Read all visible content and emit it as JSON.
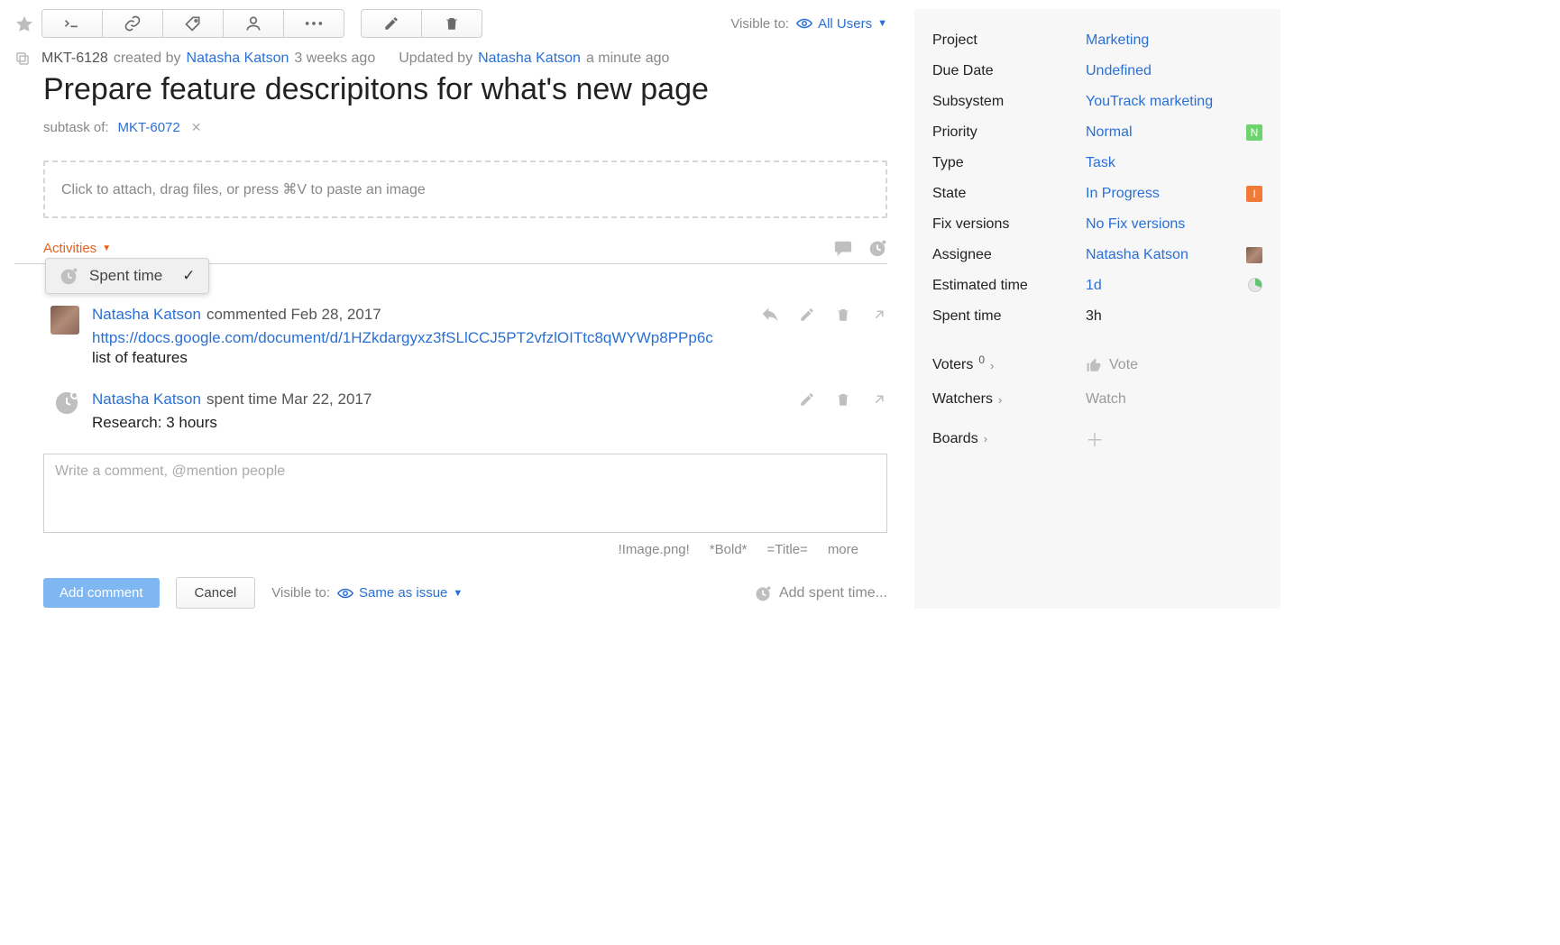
{
  "toolbar": {
    "visible_to_label": "Visible to:",
    "visible_to_value": "All Users"
  },
  "meta": {
    "issue_id": "MKT-6128",
    "created_by_label": "created by",
    "author": "Natasha Katson",
    "created_ago": "3 weeks ago",
    "updated_by_label": "Updated by",
    "updater": "Natasha Katson",
    "updated_ago": "a minute ago"
  },
  "title": "Prepare feature descripitons for what's new page",
  "subtask": {
    "label": "subtask of:",
    "parent": "MKT-6072"
  },
  "attach_placeholder": "Click to attach, drag files, or press ⌘V to paste an image",
  "activities": {
    "label": "Activities",
    "popup_item": "Spent time"
  },
  "activity1": {
    "user": "Natasha Katson",
    "action": "commented",
    "date": "Feb 28, 2017",
    "url": "https://docs.google.com/document/d/1HZkdargyxz3fSLlCCJ5PT2vfzlOITtc8qWYWp8PPp6c",
    "note": "list of features"
  },
  "activity2": {
    "user": "Natasha Katson",
    "action": "spent time",
    "date": "Mar 22, 2017",
    "note": "Research: 3 hours"
  },
  "comment_placeholder": "Write a comment, @mention people",
  "hints": {
    "image": "!Image.png!",
    "bold": "*Bold*",
    "title": "=Title=",
    "more": "more"
  },
  "bottom": {
    "add_comment": "Add comment",
    "cancel": "Cancel",
    "visible_to_label": "Visible to:",
    "visible_to_value": "Same as issue",
    "add_spent": "Add spent time..."
  },
  "fields": {
    "project": {
      "label": "Project",
      "value": "Marketing"
    },
    "due": {
      "label": "Due Date",
      "value": "Undefined"
    },
    "subsys": {
      "label": "Subsystem",
      "value": "YouTrack marketing"
    },
    "priority": {
      "label": "Priority",
      "value": "Normal",
      "badge": "N"
    },
    "type": {
      "label": "Type",
      "value": "Task"
    },
    "state": {
      "label": "State",
      "value": "In Progress",
      "badge": "I"
    },
    "fixv": {
      "label": "Fix versions",
      "value": "No Fix versions"
    },
    "assignee": {
      "label": "Assignee",
      "value": "Natasha Katson"
    },
    "est": {
      "label": "Estimated time",
      "value": "1d"
    },
    "spent": {
      "label": "Spent time",
      "value": "3h"
    }
  },
  "side": {
    "voters": "Voters",
    "voters_count": "0",
    "vote": "Vote",
    "watchers": "Watchers",
    "watch": "Watch",
    "boards": "Boards"
  }
}
